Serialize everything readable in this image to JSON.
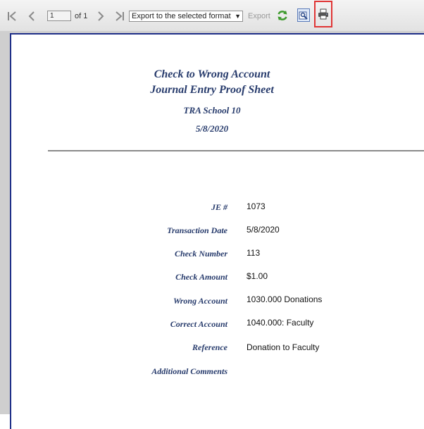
{
  "toolbar": {
    "page_current": "1",
    "page_of": "of 1",
    "export_format": "Export to the selected format",
    "export_label": "Export",
    "icons": {
      "first": "first-page-icon",
      "prev": "previous-page-icon",
      "next": "next-page-icon",
      "last": "last-page-icon",
      "refresh": "refresh-icon",
      "search": "find-icon",
      "print": "printer-icon"
    },
    "highlight_color": "#e03535"
  },
  "report": {
    "title_line1": "Check to Wrong Account",
    "title_line2": "Journal Entry Proof Sheet",
    "school": "TRA School 10",
    "date": "5/8/2020",
    "fields": [
      {
        "label": "JE #",
        "value": "1073"
      },
      {
        "label": "Transaction Date",
        "value": "5/8/2020"
      },
      {
        "label": "Check Number",
        "value": "113"
      },
      {
        "label": "Check Amount",
        "value": "$1.00"
      },
      {
        "label": "Wrong Account",
        "value": "1030.000 Donations"
      },
      {
        "label": "Correct Account",
        "value": "1040.000: Faculty"
      },
      {
        "label": "Reference",
        "value": "Donation to Faculty"
      },
      {
        "label": "Additional Comments",
        "value": ""
      }
    ],
    "title_color": "#273b6c"
  }
}
